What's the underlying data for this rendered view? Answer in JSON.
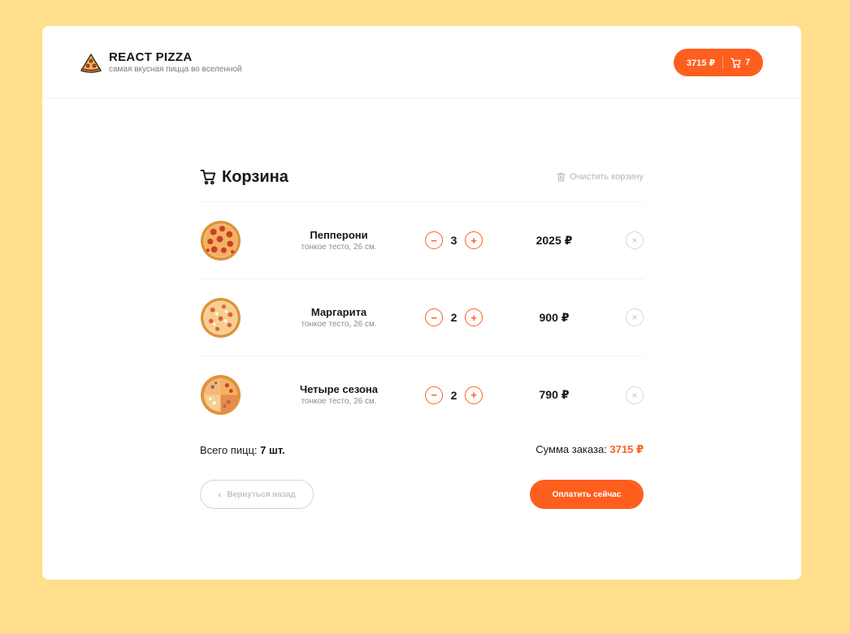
{
  "header": {
    "logo_title": "REACT PIZZA",
    "logo_subtitle": "самая вкусная пицца во вселенной",
    "cart_button": {
      "total": "3715 ₽",
      "count": "7",
      "icon": "cart-icon"
    }
  },
  "cart": {
    "title": "Корзина",
    "title_icon": "cart-icon",
    "clear_label": "Очистить корзину",
    "clear_icon": "trash-icon",
    "items": [
      {
        "name": "Пепперони",
        "desc": "тонкое тесто, 26 см.",
        "count": "3",
        "price": "2025 ₽"
      },
      {
        "name": "Маргарита",
        "desc": "тонкое тесто, 26 см.",
        "count": "2",
        "price": "900 ₽"
      },
      {
        "name": "Четыре сезона",
        "desc": "тонкое тесто, 26 см.",
        "count": "2",
        "price": "790 ₽"
      }
    ],
    "minus_symbol": "−",
    "plus_symbol": "+",
    "remove_symbol": "×",
    "total_pizzas_label": "Всего пицц:",
    "total_pizzas_value": "7 шт.",
    "sum_label": "Сумма заказа:",
    "sum_value": "3715 ₽",
    "back_label": "Вернуться назад",
    "back_chevron": "‹",
    "pay_label": "Оплатить сейчас"
  },
  "colors": {
    "background": "#ffdf8c",
    "accent": "#fe5f1e",
    "text": "#181818",
    "muted": "#8d8d8d"
  }
}
